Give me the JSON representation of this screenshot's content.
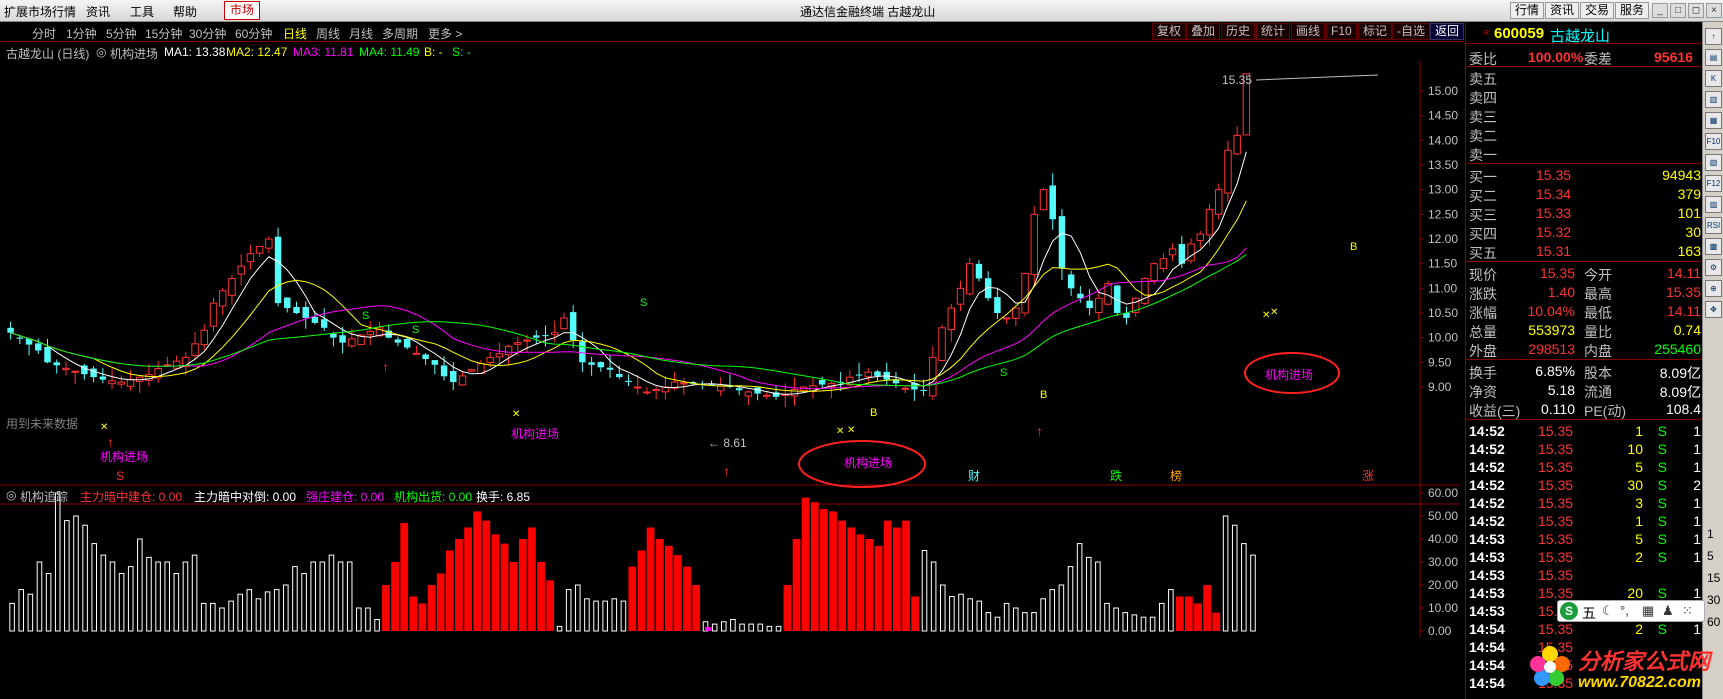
{
  "titlebar": {
    "menus": [
      "扩展市场行情",
      "资讯",
      "工具",
      "帮助"
    ],
    "market": "市场",
    "title": "通达信金融终端  古越龙山",
    "right_buttons": [
      "行情",
      "资讯",
      "交易",
      "服务"
    ]
  },
  "toolbar": {
    "periods": [
      "分时",
      "1分钟",
      "5分钟",
      "15分钟",
      "30分钟",
      "60分钟",
      "日线",
      "周线",
      "月线",
      "多周期",
      "更多 >"
    ],
    "active_period": "日线",
    "buttons": [
      "复权",
      "叠加",
      "历史",
      "统计",
      "画线",
      "F10",
      "标记",
      "-自选",
      "返回"
    ]
  },
  "legend": {
    "stock": "古越龙山 (日线)",
    "indicator": "机构进场",
    "ma1": "MA1: 13.38",
    "ma2": "MA2: 12.47",
    "ma3": "MA3: 11.81",
    "ma4": "MA4: 11.49",
    "b": "B: -",
    "s": "S: -"
  },
  "main_chart": {
    "price_ticks": [
      "15.00",
      "14.50",
      "14.00",
      "13.50",
      "13.00",
      "12.50",
      "12.00",
      "11.50",
      "11.00",
      "10.50",
      "10.00",
      "9.50",
      "9.00"
    ],
    "high_label": "15.35",
    "low_label": "8.61",
    "annotations": [
      "机构进场",
      "机构进场",
      "机构进场",
      "机构进场"
    ],
    "future_label": "用到未来数据",
    "bottom_marks": [
      "S",
      "财",
      "跌",
      "榜",
      "涨"
    ]
  },
  "sub_chart": {
    "title": "机构追踪",
    "items": [
      {
        "label": "主力暗中建仓: 0.00",
        "color": "#ff3232"
      },
      {
        "label": "主力暗中对倒: 0.00",
        "color": "#ffffff"
      },
      {
        "label": "强庄建仓: 0.00",
        "color": "#ff00ff"
      },
      {
        "label": "机构出货: 0.00",
        "color": "#00ff00"
      },
      {
        "label": "换手: 6.85",
        "color": "#ffffff"
      }
    ],
    "ticks": [
      "60.00",
      "50.00",
      "40.00",
      "30.00",
      "20.00",
      "10.00",
      "0.00"
    ]
  },
  "chart_data": {
    "type": "bar",
    "title": "机构追踪",
    "red_volume_series": [
      0,
      0,
      0,
      0,
      0,
      0,
      0,
      0,
      0,
      0,
      0,
      0,
      0,
      0,
      0,
      0,
      0,
      0,
      0,
      0,
      0,
      0,
      0,
      0,
      0,
      0,
      0,
      0,
      0,
      0,
      0,
      0,
      0,
      0,
      0,
      0,
      0,
      0,
      0,
      0,
      0,
      20,
      30,
      47,
      15,
      12,
      20,
      25,
      35,
      40,
      45,
      52,
      48,
      42,
      38,
      30,
      40,
      45,
      30,
      22,
      0,
      0,
      0,
      0,
      0,
      0,
      0,
      0,
      0,
      0,
      0,
      0,
      0,
      0,
      0,
      0,
      0,
      0,
      0,
      0,
      0,
      0,
      0,
      0,
      0,
      0,
      0,
      0,
      0,
      0,
      0,
      0,
      0,
      0,
      0,
      0,
      0,
      0,
      0,
      0
    ],
    "ylim": [
      0,
      63
    ]
  },
  "quote": {
    "code": "600059",
    "name": "古越龙山",
    "weibi_label": "委比",
    "weibi": "100.00%",
    "weicha_label": "委差",
    "weicha": "95616",
    "asks": [
      {
        "label": "卖五"
      },
      {
        "label": "卖四"
      },
      {
        "label": "卖三"
      },
      {
        "label": "卖二"
      },
      {
        "label": "卖一"
      }
    ],
    "bids": [
      {
        "label": "买一",
        "price": "15.35",
        "vol": "94943"
      },
      {
        "label": "买二",
        "price": "15.34",
        "vol": "379"
      },
      {
        "label": "买三",
        "price": "15.33",
        "vol": "101"
      },
      {
        "label": "买四",
        "price": "15.32",
        "vol": "30"
      },
      {
        "label": "买五",
        "price": "15.31",
        "vol": "163"
      }
    ],
    "stats": [
      {
        "l1": "现价",
        "v1": "15.35",
        "c1": "red",
        "l2": "今开",
        "v2": "14.11",
        "c2": "red"
      },
      {
        "l1": "涨跌",
        "v1": "1.40",
        "c1": "red",
        "l2": "最高",
        "v2": "15.35",
        "c2": "red"
      },
      {
        "l1": "涨幅",
        "v1": "10.04%",
        "c1": "red",
        "l2": "最低",
        "v2": "14.11",
        "c2": "red"
      },
      {
        "l1": "总量",
        "v1": "553973",
        "c1": "yel",
        "l2": "量比",
        "v2": "0.74",
        "c2": "yel"
      },
      {
        "l1": "外盘",
        "v1": "298513",
        "c1": "red",
        "l2": "内盘",
        "v2": "255460",
        "c2": "grn"
      }
    ],
    "fin": [
      {
        "l1": "换手",
        "v1": "6.85%",
        "l2": "股本",
        "v2": "8.09亿"
      },
      {
        "l1": "净资",
        "v1": "5.18",
        "l2": "流通",
        "v2": "8.09亿"
      },
      {
        "l1": "收益(三)",
        "v1": "0.110",
        "l2": "PE(动)",
        "v2": "108.4"
      }
    ],
    "ticks": [
      {
        "t": "14:52",
        "p": "15.35",
        "v": "1",
        "s": "S",
        "n": "1"
      },
      {
        "t": "14:52",
        "p": "15.35",
        "v": "10",
        "s": "S",
        "n": "1"
      },
      {
        "t": "14:52",
        "p": "15.35",
        "v": "5",
        "s": "S",
        "n": "1"
      },
      {
        "t": "14:52",
        "p": "15.35",
        "v": "30",
        "s": "S",
        "n": "2"
      },
      {
        "t": "14:52",
        "p": "15.35",
        "v": "3",
        "s": "S",
        "n": "1"
      },
      {
        "t": "14:52",
        "p": "15.35",
        "v": "1",
        "s": "S",
        "n": "1"
      },
      {
        "t": "14:53",
        "p": "15.35",
        "v": "5",
        "s": "S",
        "n": "1"
      },
      {
        "t": "14:53",
        "p": "15.35",
        "v": "2",
        "s": "S",
        "n": "1"
      },
      {
        "t": "14:53",
        "p": "15.35",
        "v": "",
        "s": "",
        "n": ""
      },
      {
        "t": "14:53",
        "p": "15.35",
        "v": "20",
        "s": "S",
        "n": "1"
      },
      {
        "t": "14:53",
        "p": "15.35",
        "v": "1",
        "s": "S",
        "n": "1"
      },
      {
        "t": "14:54",
        "p": "15.35",
        "v": "2",
        "s": "S",
        "n": "1"
      },
      {
        "t": "14:54",
        "p": "15.35",
        "v": "",
        "s": "",
        "n": ""
      },
      {
        "t": "14:54",
        "p": "15.35",
        "v": "",
        "s": "",
        "n": ""
      },
      {
        "t": "14:54",
        "p": "15.35",
        "v": "",
        "s": "",
        "n": ""
      }
    ]
  },
  "sidebar": {
    "icons": [
      "up-arrow-icon",
      "chart-icon",
      "k-line-icon",
      "quote-icon",
      "news-icon",
      "f10-icon",
      "table-icon",
      "f12-icon",
      "map-icon",
      "rsi-icon",
      "fund-icon",
      "setting-icon",
      "zoom-icon",
      "arrow-icon"
    ],
    "labels": [
      "F10",
      "F12",
      "RSI"
    ],
    "nums": [
      "1",
      "5",
      "15",
      "30",
      "60"
    ]
  },
  "ime": {
    "label": "五"
  },
  "watermark": {
    "text": "分析家公式网",
    "url": "www.70822.com"
  }
}
